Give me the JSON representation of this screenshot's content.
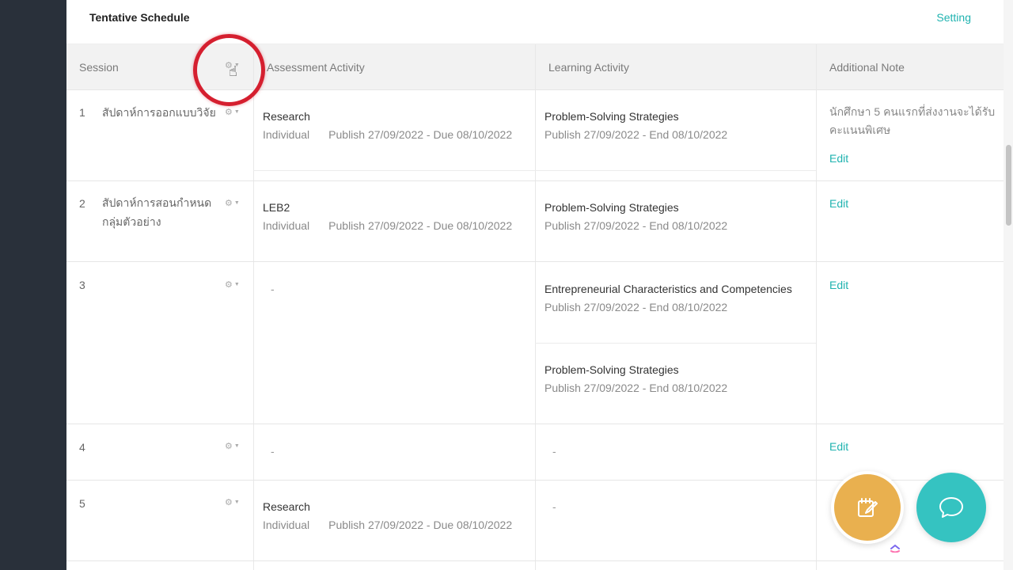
{
  "panel": {
    "title": "Tentative Schedule",
    "setting_label": "Setting"
  },
  "columns": {
    "session": "Session",
    "assessment": "Assessment Activity",
    "learning": "Learning Activity",
    "note": "Additional Note"
  },
  "icons": {
    "gear": "⚙",
    "caret": "▼",
    "cursor": "☝"
  },
  "rows": [
    {
      "num": "1",
      "name": "สัปดาห์การออกแบบวิจัย",
      "assessment": {
        "title": "Research",
        "type": "Individual",
        "dates": "Publish 27/09/2022 - Due 08/10/2022"
      },
      "learning": [
        {
          "title": "Problem-Solving Strategies",
          "dates": "Publish 27/09/2022 - End 08/10/2022"
        }
      ],
      "note": "นักศึกษา 5 คนแรกที่ส่งงานจะได้รับคะแนนพิเศษ",
      "edit": "Edit"
    },
    {
      "num": "2",
      "name": "สัปดาห์การสอนกำหนดกลุ่มตัวอย่าง",
      "assessment": {
        "title": "LEB2",
        "type": "Individual",
        "dates": "Publish 27/09/2022 - Due 08/10/2022"
      },
      "learning": [
        {
          "title": "Problem-Solving Strategies",
          "dates": "Publish 27/09/2022 - End 08/10/2022"
        }
      ],
      "edit": "Edit"
    },
    {
      "num": "3",
      "assessment_empty": "-",
      "learning": [
        {
          "title": "Entrepreneurial Characteristics and Competencies",
          "dates": "Publish 27/09/2022 - End 08/10/2022"
        },
        {
          "title": "Problem-Solving Strategies",
          "dates": "Publish 27/09/2022 - End 08/10/2022"
        }
      ],
      "edit": "Edit"
    },
    {
      "num": "4",
      "assessment_empty": "-",
      "learning_empty": "-",
      "edit": "Edit"
    },
    {
      "num": "5",
      "assessment": {
        "title": "Research",
        "type": "Individual",
        "dates": "Publish 27/09/2022 - Due 08/10/2022"
      },
      "learning_empty": "-"
    }
  ],
  "colors": {
    "accent": "#20b3b0",
    "highlight": "#d51f2f",
    "fab_edit": "#e9b04f",
    "fab_chat": "#35c3c1",
    "rail": "#29303a"
  }
}
